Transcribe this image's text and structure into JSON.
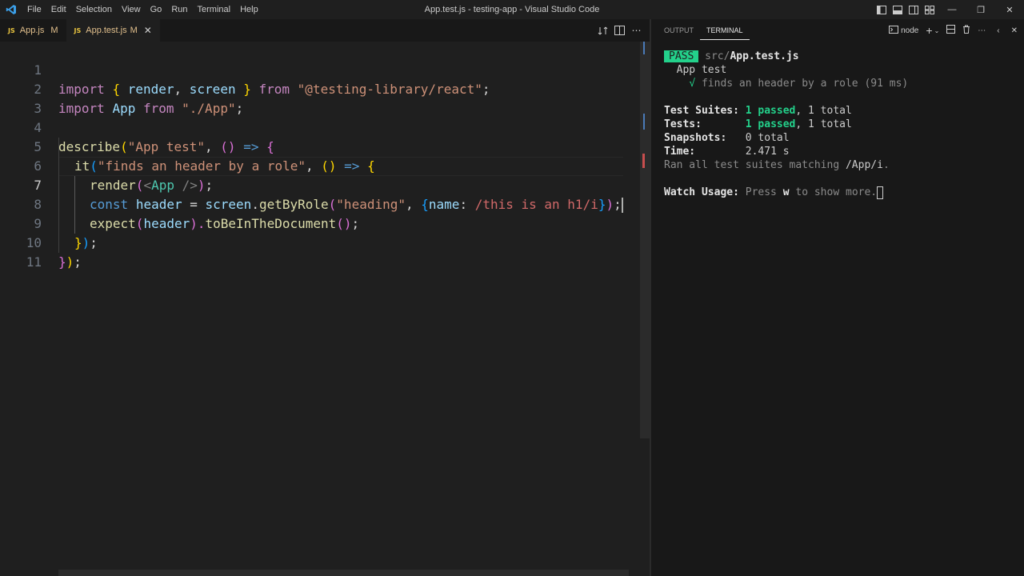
{
  "window": {
    "title": "App.test.js - testing-app - Visual Studio Code"
  },
  "menu": [
    "File",
    "Edit",
    "Selection",
    "View",
    "Go",
    "Run",
    "Terminal",
    "Help"
  ],
  "tabs": [
    {
      "icon": "JS",
      "name": "App.js",
      "status": "M"
    },
    {
      "icon": "JS",
      "name": "App.test.js",
      "status": "M",
      "close": "✕"
    }
  ],
  "editor": {
    "line_numbers": [
      "1",
      "2",
      "3",
      "4",
      "5",
      "6",
      "7",
      "8",
      "9",
      "10",
      "11"
    ],
    "lines": {
      "l1": [
        "import",
        " ",
        "{",
        " ",
        "render",
        ", ",
        "screen",
        " ",
        "}",
        " ",
        "from",
        " ",
        "\"@testing-library/react\"",
        ";"
      ],
      "l2": [
        "import",
        " ",
        "App",
        " ",
        "from",
        " ",
        "\"./App\"",
        ";"
      ],
      "l4": [
        "describe",
        "(",
        "\"App test\"",
        ", ",
        "()",
        " ",
        "=>",
        " ",
        "{"
      ],
      "l5": [
        "it",
        "(",
        "\"finds an header by a role\"",
        ", ",
        "()",
        " ",
        "=>",
        " ",
        "{"
      ],
      "l6": [
        "render",
        "(",
        "<",
        "App",
        " />",
        ")",
        ";"
      ],
      "l7": [
        "const",
        " ",
        "header",
        " = ",
        "screen",
        ".",
        "getByRole",
        "(",
        "\"heading\"",
        ", ",
        "{",
        "name",
        ": ",
        "/this is an h1/i",
        "}",
        ")",
        ";"
      ],
      "l8": [
        "expect",
        "(",
        "header",
        ").",
        "toBeInTheDocument",
        "()",
        ";"
      ],
      "l9": [
        "}",
        ")",
        ";"
      ],
      "l10": [
        "}",
        ")",
        ";"
      ]
    }
  },
  "panel": {
    "tabs": [
      "OUTPUT",
      "TERMINAL"
    ],
    "shell": "node",
    "terminal": {
      "pass_badge": "PASS",
      "file_dir": "src/",
      "file_name": "App.test.js",
      "suite": "App test",
      "check": "√",
      "test_line": "finds an header by a role (91 ms)",
      "suites_label": "Test Suites:",
      "suites_passed": "1 passed",
      "suites_total": ", 1 total",
      "tests_label": "Tests:",
      "tests_passed": "1 passed",
      "tests_total": ", 1 total",
      "snapshots_label": "Snapshots:",
      "snapshots_value": "0 total",
      "time_label": "Time:",
      "time_value": "2.471 s",
      "ran_prefix": "Ran all test suites matching ",
      "ran_pattern": "/App/i",
      "ran_suffix": ".",
      "watch_label": "Watch Usage:",
      "watch_pre": " Press ",
      "watch_key": "w",
      "watch_post": " to show more."
    }
  },
  "colors": {
    "pass": "#23d18b",
    "modified": "#e2c08d",
    "js_icon": "#e8c33f"
  }
}
